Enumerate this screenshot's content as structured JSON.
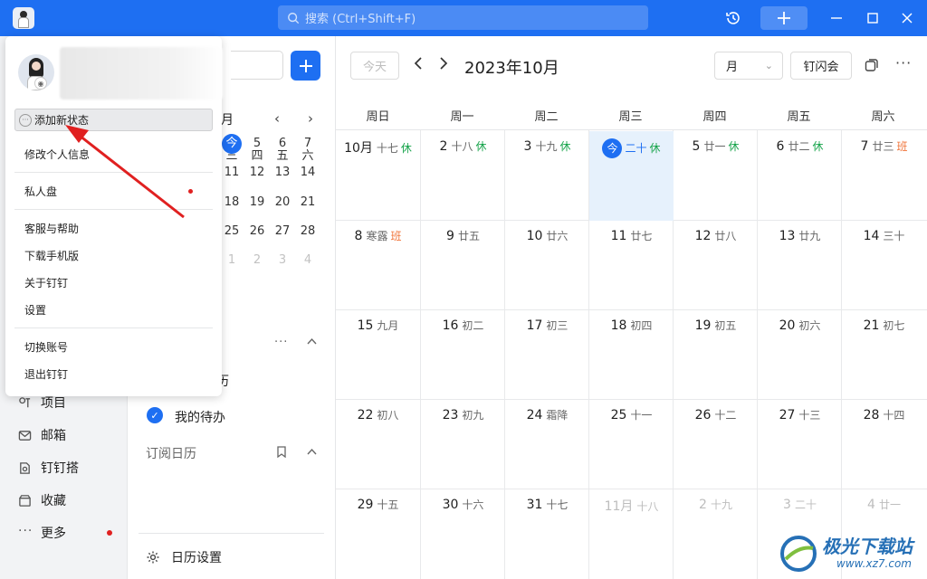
{
  "titlebar": {
    "search_placeholder": "搜索 (Ctrl+Shift+F)"
  },
  "leftnav": {
    "items": [
      {
        "label": "项目",
        "icon": "project-icon"
      },
      {
        "label": "邮箱",
        "icon": "mail-icon"
      },
      {
        "label": "钉钉搭",
        "icon": "builder-icon"
      },
      {
        "label": "收藏",
        "icon": "favorites-icon"
      },
      {
        "label": "更多",
        "icon": "more-icon"
      }
    ]
  },
  "midpanel": {
    "month_fragment": "月",
    "mini_weekdays": [
      "三",
      "四",
      "五",
      "六"
    ],
    "mini_rows": [
      [
        "今",
        "5",
        "6",
        "7"
      ],
      [
        "11",
        "12",
        "13",
        "14"
      ],
      [
        "18",
        "19",
        "20",
        "21"
      ],
      [
        "25",
        "26",
        "27",
        "28"
      ],
      [
        "1",
        "2",
        "3",
        "4"
      ]
    ],
    "my_calendar_fragment": "历",
    "todo_label": "我的待办",
    "subscribed_label": "订阅日历",
    "settings_label": "日历设置"
  },
  "calendar": {
    "today_btn": "今天",
    "title": "2023年10月",
    "view": "月",
    "flash_meeting": "钉闪会",
    "weekdays": [
      "周日",
      "周一",
      "周二",
      "周三",
      "周四",
      "周五",
      "周六"
    ],
    "weeks": [
      [
        {
          "d": "10月",
          "l": "十七",
          "h": "休"
        },
        {
          "d": "2",
          "l": "十八",
          "h": "休"
        },
        {
          "d": "3",
          "l": "十九",
          "h": "休"
        },
        {
          "d": "今",
          "l": "二十",
          "h": "休"
        },
        {
          "d": "5",
          "l": "廿一",
          "h": "休"
        },
        {
          "d": "6",
          "l": "廿二",
          "h": "休"
        },
        {
          "d": "7",
          "l": "廿三",
          "h": "班"
        }
      ],
      [
        {
          "d": "8",
          "l": "寒露",
          "h": "班"
        },
        {
          "d": "9",
          "l": "廿五",
          "h": ""
        },
        {
          "d": "10",
          "l": "廿六",
          "h": ""
        },
        {
          "d": "11",
          "l": "廿七",
          "h": ""
        },
        {
          "d": "12",
          "l": "廿八",
          "h": ""
        },
        {
          "d": "13",
          "l": "廿九",
          "h": ""
        },
        {
          "d": "14",
          "l": "三十",
          "h": ""
        }
      ],
      [
        {
          "d": "15",
          "l": "九月",
          "h": ""
        },
        {
          "d": "16",
          "l": "初二",
          "h": ""
        },
        {
          "d": "17",
          "l": "初三",
          "h": ""
        },
        {
          "d": "18",
          "l": "初四",
          "h": ""
        },
        {
          "d": "19",
          "l": "初五",
          "h": ""
        },
        {
          "d": "20",
          "l": "初六",
          "h": ""
        },
        {
          "d": "21",
          "l": "初七",
          "h": ""
        }
      ],
      [
        {
          "d": "22",
          "l": "初八",
          "h": ""
        },
        {
          "d": "23",
          "l": "初九",
          "h": ""
        },
        {
          "d": "24",
          "l": "霜降",
          "h": ""
        },
        {
          "d": "25",
          "l": "十一",
          "h": ""
        },
        {
          "d": "26",
          "l": "十二",
          "h": ""
        },
        {
          "d": "27",
          "l": "十三",
          "h": ""
        },
        {
          "d": "28",
          "l": "十四",
          "h": ""
        }
      ],
      [
        {
          "d": "29",
          "l": "十五",
          "h": ""
        },
        {
          "d": "30",
          "l": "十六",
          "h": ""
        },
        {
          "d": "31",
          "l": "十七",
          "h": ""
        },
        {
          "d": "11月",
          "l": "十八",
          "h": "",
          "dim": true
        },
        {
          "d": "2",
          "l": "十九",
          "h": "",
          "dim": true
        },
        {
          "d": "3",
          "l": "二十",
          "h": "",
          "dim": true
        },
        {
          "d": "4",
          "l": "廿一",
          "h": "",
          "dim": true
        }
      ]
    ]
  },
  "popup": {
    "add_status": "添加新状态",
    "items": [
      "修改个人信息",
      "私人盘",
      "客服与帮助",
      "下载手机版",
      "关于钉钉",
      "设置",
      "切换账号",
      "退出钉钉"
    ]
  },
  "watermark": {
    "text": "极光下载站",
    "url": "www.xz7.com"
  },
  "colors": {
    "brand": "#1e6ff2",
    "rest": "#16a34a",
    "work": "#f0743a",
    "annotation": "#e02020"
  }
}
